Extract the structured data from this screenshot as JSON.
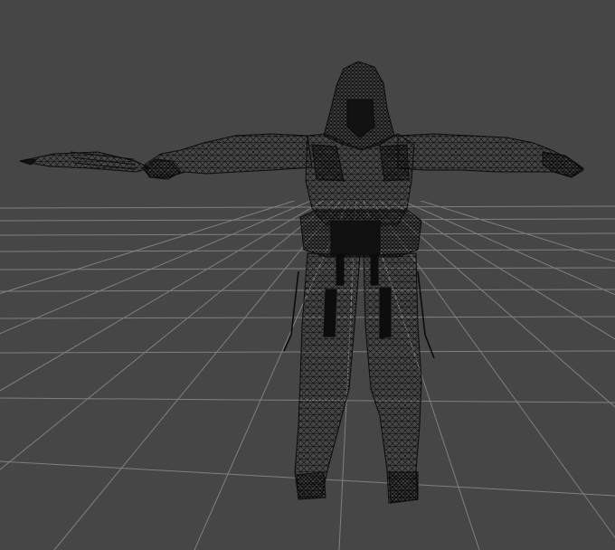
{
  "viewport": {
    "background_color": "#464646",
    "grid_color": "#8c8c8c",
    "wire_color": "#000000",
    "render_mode": "wireframe",
    "object_pose": "T-pose",
    "object_type": "humanoid-character-mesh",
    "held_item": "sword"
  }
}
